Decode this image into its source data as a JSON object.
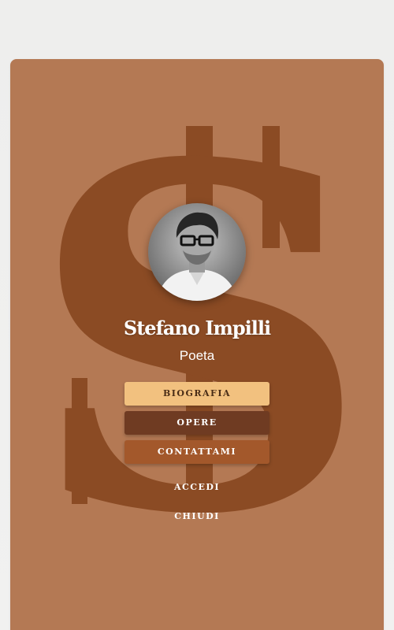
{
  "profile": {
    "name": "Stefano Impilli",
    "role": "Poeta",
    "monogram": "S"
  },
  "menu": {
    "biografia": "BIOGRAFIA",
    "opere": "OPERE",
    "contattami": "CONTATTAMI"
  },
  "links": {
    "accedi": "ACCEDI",
    "chiudi": "CHIUDI"
  },
  "colors": {
    "card_bg": "#b47954",
    "monogram": "#8b4b24",
    "biografia_button": "#f2c17f",
    "opere_button": "#6f3b22",
    "contattami_button": "#a3582b"
  }
}
